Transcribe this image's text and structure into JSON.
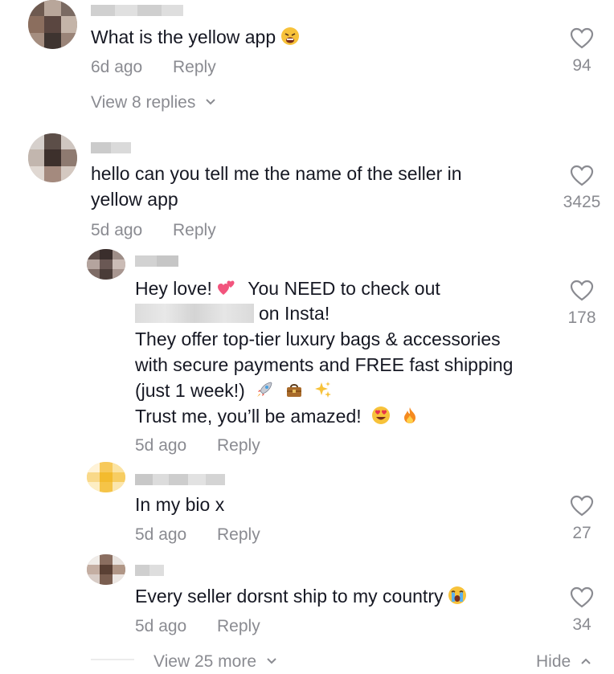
{
  "comments": [
    {
      "text": "What is the yellow app",
      "time": "6d ago",
      "reply_label": "Reply",
      "likes": "94",
      "view_replies": "View 8 replies",
      "emoji_icon": "weary-face-icon"
    },
    {
      "lines": [
        "hello can you tell me the name of the seller in",
        "yellow app"
      ],
      "time": "5d ago",
      "reply_label": "Reply",
      "likes": "3425"
    }
  ],
  "replies": [
    {
      "line1": "Hey love!",
      "line1b": "You NEED to check out",
      "line2": "on Insta!",
      "line3": "They offer top-tier luxury bags & accessories",
      "line4": "with secure payments and FREE fast shipping",
      "line5": "(just 1 week!)",
      "line6": "Trust me, you’ll be amazed!",
      "time": "5d ago",
      "reply_label": "Reply",
      "likes": "178",
      "icons": [
        "two-hearts-icon",
        "rocket-icon",
        "handbag-icon",
        "sparkles-icon",
        "heart-eyes-icon",
        "fire-icon"
      ]
    },
    {
      "text": "In my bio x",
      "time": "5d ago",
      "reply_label": "Reply",
      "likes": "27"
    },
    {
      "text": "Every seller dorsnt ship to my country",
      "time": "5d ago",
      "reply_label": "Reply",
      "likes": "34",
      "emoji_icon": "crying-face-icon"
    }
  ],
  "footer": {
    "view_more": "View 25 more",
    "hide": "Hide"
  },
  "colors": {
    "text": "#161823",
    "muted": "#8a8b91",
    "emoji_yellow": "#f7c23a",
    "heart_pink": "#f2547d"
  }
}
